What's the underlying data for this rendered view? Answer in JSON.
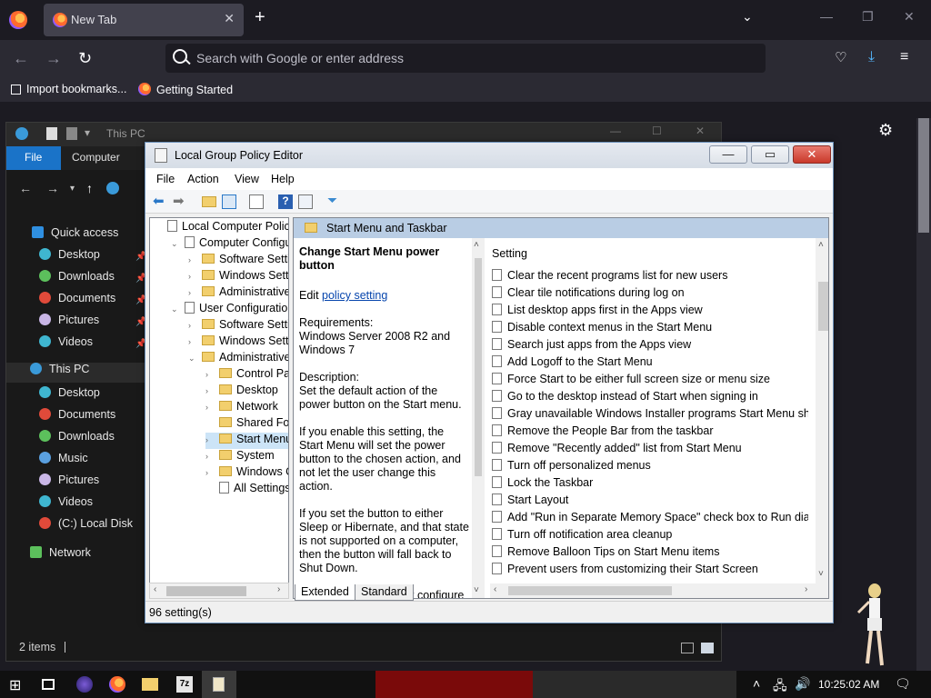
{
  "browser": {
    "tab_title": "New Tab",
    "address_placeholder": "Search with Google or enter address",
    "bookmarks": [
      "Import bookmarks...",
      "Getting Started"
    ]
  },
  "explorer": {
    "title": "This PC",
    "ribbon": {
      "file": "File",
      "computer": "Computer"
    },
    "quick_access": "Quick access",
    "quick_items": [
      "Desktop",
      "Downloads",
      "Documents",
      "Pictures",
      "Videos"
    ],
    "this_pc": "This PC",
    "pc_items": [
      "Desktop",
      "Documents",
      "Downloads",
      "Music",
      "Pictures",
      "Videos",
      "(C:) Local Disk"
    ],
    "network": "Network",
    "status": "2 items"
  },
  "gpe": {
    "title": "Local Group Policy Editor",
    "menu": [
      "File",
      "Action",
      "View",
      "Help"
    ],
    "tree": [
      {
        "label": "Local Computer Policy",
        "indent": 0,
        "exp": "",
        "icon": "doc"
      },
      {
        "label": "Computer Configura",
        "indent": 1,
        "exp": "v",
        "icon": "doc"
      },
      {
        "label": "Software Settings",
        "indent": 2,
        "exp": ">",
        "icon": "folder"
      },
      {
        "label": "Windows Setting",
        "indent": 2,
        "exp": ">",
        "icon": "folder"
      },
      {
        "label": "Administrative Te",
        "indent": 2,
        "exp": ">",
        "icon": "folder"
      },
      {
        "label": "User Configuration",
        "indent": 1,
        "exp": "v",
        "icon": "doc"
      },
      {
        "label": "Software Settings",
        "indent": 2,
        "exp": ">",
        "icon": "folder"
      },
      {
        "label": "Windows Setting",
        "indent": 2,
        "exp": ">",
        "icon": "folder"
      },
      {
        "label": "Administrative Te",
        "indent": 2,
        "exp": "v",
        "icon": "folder"
      },
      {
        "label": "Control Panel",
        "indent": 3,
        "exp": ">",
        "icon": "folder"
      },
      {
        "label": "Desktop",
        "indent": 3,
        "exp": ">",
        "icon": "folder"
      },
      {
        "label": "Network",
        "indent": 3,
        "exp": ">",
        "icon": "folder"
      },
      {
        "label": "Shared Folder",
        "indent": 3,
        "exp": "",
        "icon": "folder"
      },
      {
        "label": "Start Menu ar",
        "indent": 3,
        "exp": ">",
        "icon": "folder",
        "selected": true
      },
      {
        "label": "System",
        "indent": 3,
        "exp": ">",
        "icon": "folder"
      },
      {
        "label": "Windows Cor",
        "indent": 3,
        "exp": ">",
        "icon": "folder"
      },
      {
        "label": "All Settings",
        "indent": 3,
        "exp": "",
        "icon": "doc"
      }
    ],
    "detail_header": "Start Menu and Taskbar",
    "description": {
      "title": "Change Start Menu power button",
      "edit_prefix": "Edit",
      "edit_link": "policy setting",
      "requirements": "Requirements:",
      "requirements_value": "Windows Server 2008 R2 and Windows 7",
      "desc_label": "Description:",
      "desc_text": "Set the default action of the power button on the Start menu.",
      "p1": "If you enable this setting, the Start Menu will set the power button to the chosen action, and not let the user change this action.",
      "p2": "If you set the button to either Sleep or Hibernate, and that state is not supported on a computer, then the button will fall back to Shut Down.",
      "p3": "If you disable or do not configure this setting, the Start Menu power"
    },
    "settings_header": "Setting",
    "settings": [
      "Clear the recent programs list for new users",
      "Clear tile notifications during log on",
      "List desktop apps first in the Apps view",
      "Disable context menus in the Start Menu",
      "Search just apps from the Apps view",
      "Add Logoff to the Start Menu",
      "Force Start to be either full screen size or menu size",
      "Go to the desktop instead of Start when signing in",
      "Gray unavailable Windows Installer programs Start Menu sh...",
      "Remove the People Bar from the taskbar",
      "Remove \"Recently added\" list from Start Menu",
      "Turn off personalized menus",
      "Lock the Taskbar",
      "Start Layout",
      "Add \"Run in Separate Memory Space\" check box to Run dial...",
      "Turn off notification area cleanup",
      "Remove Balloon Tips on Start Menu items",
      "Prevent users from customizing their Start Screen"
    ],
    "tabs": [
      "Extended",
      "Standard"
    ],
    "status": "96 setting(s)"
  },
  "taskbar": {
    "clock": "10:25:02 AM"
  },
  "colors": {
    "explorer_file_tab": "#1a73c8",
    "gpe_close": "#c9392a",
    "detail_header": "#b9cde4"
  }
}
